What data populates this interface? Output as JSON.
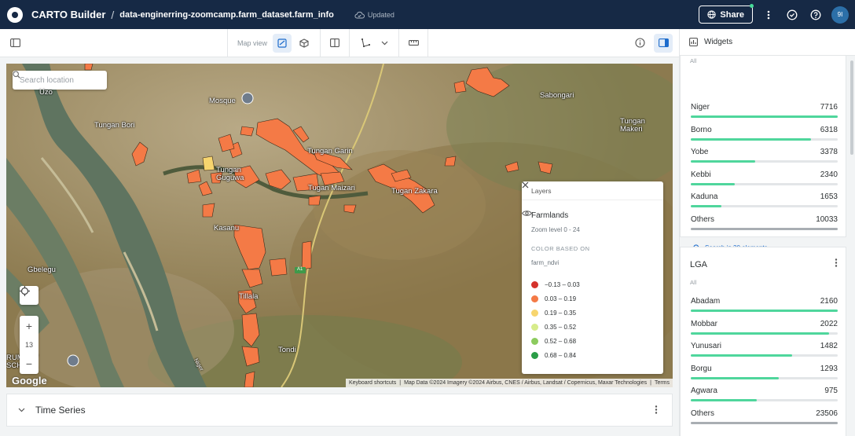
{
  "header": {
    "app_title": "CARTO Builder",
    "separator": "/",
    "dataset": "data-enginerring-zoomcamp.farm_dataset.farm_info",
    "status": "Updated",
    "share_label": "Share",
    "avatar_initials": "9I"
  },
  "toolbar": {
    "mapview_label": "Map view"
  },
  "map": {
    "search_placeholder": "Search location",
    "zoom_level": "13",
    "zoom_in": "+",
    "zoom_out": "−",
    "google_label": "Google",
    "attribution": {
      "shortcuts": "Keyboard shortcuts",
      "data": "Map Data ©2024 Imagery ©2024 Airbus, CNES / Airbus, Landsat / Copernicus, Maxar Technologies",
      "terms": "Terms"
    },
    "places": [
      {
        "name": "Uzo"
      },
      {
        "name": "Mosque"
      },
      {
        "name": "Tungan Bori"
      },
      {
        "name": "Tungan Garin"
      },
      {
        "name": "Tungan Guguwa"
      },
      {
        "name": "Tugan Maizari"
      },
      {
        "name": "Tugan Zakara"
      },
      {
        "name": "Sabongari"
      },
      {
        "name": "Tungan Makeri"
      },
      {
        "name": "Kasanu"
      },
      {
        "name": "Gbelegu"
      },
      {
        "name": "Tillala"
      },
      {
        "name": "Tondi"
      },
      {
        "name": "RUMARY SCHOOL"
      },
      {
        "name": "A1"
      },
      {
        "name": "Niger"
      }
    ]
  },
  "layers_panel": {
    "title": "Layers",
    "layer_name": "Farmlands",
    "zoom_range": "Zoom level 0 - 24",
    "color_based_on": "COLOR BASED ON",
    "field": "farm_ndvi",
    "legend": [
      {
        "label": "−0.13 – 0.03",
        "color": "#d4322c"
      },
      {
        "label": "0.03 – 0.19",
        "color": "#f47a46"
      },
      {
        "label": "0.19 – 0.35",
        "color": "#f7d56e"
      },
      {
        "label": "0.35 – 0.52",
        "color": "#d7ec8b"
      },
      {
        "label": "0.52 – 0.68",
        "color": "#8ccb5e"
      },
      {
        "label": "0.68 – 0.84",
        "color": "#2a9d47"
      }
    ]
  },
  "time_series": {
    "title": "Time Series"
  },
  "widgets": {
    "title": "Widgets",
    "state_card": {
      "all_label": "All",
      "rows": [
        {
          "label": "Niger",
          "value": "7716",
          "fraction": 1.0
        },
        {
          "label": "Borno",
          "value": "6318",
          "fraction": 0.82
        },
        {
          "label": "Yobe",
          "value": "3378",
          "fraction": 0.44
        },
        {
          "label": "Kebbi",
          "value": "2340",
          "fraction": 0.3
        },
        {
          "label": "Kaduna",
          "value": "1653",
          "fraction": 0.21
        },
        {
          "label": "Others",
          "value": "10033",
          "fraction": 1.0
        }
      ],
      "search_link": "Search in 30 elements"
    },
    "lga_card": {
      "title": "LGA",
      "all_label": "All",
      "rows": [
        {
          "label": "Abadam",
          "value": "2160",
          "fraction": 1.0
        },
        {
          "label": "Mobbar",
          "value": "2022",
          "fraction": 0.94
        },
        {
          "label": "Yunusari",
          "value": "1482",
          "fraction": 0.69
        },
        {
          "label": "Borgu",
          "value": "1293",
          "fraction": 0.6
        },
        {
          "label": "Agwara",
          "value": "975",
          "fraction": 0.45
        },
        {
          "label": "Others",
          "value": "23506",
          "fraction": 1.0
        }
      ]
    }
  },
  "colors": {
    "header_bg": "#162945",
    "accent": "#1d6ccc",
    "bar_fill": "#4fd69c",
    "farm_polygon": "#f47a46"
  }
}
